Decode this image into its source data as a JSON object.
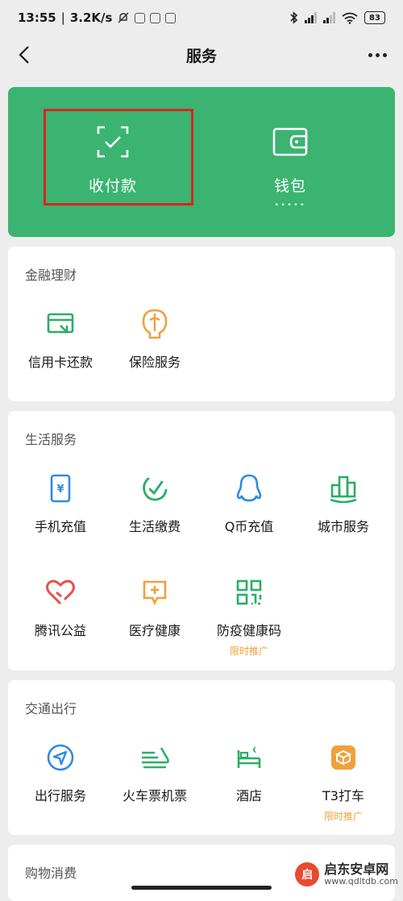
{
  "status_bar": {
    "time": "13:55",
    "speed": "3.2K/s",
    "battery": "83"
  },
  "nav": {
    "title": "服务"
  },
  "hero": {
    "pay_label": "收付款",
    "wallet_label": "钱包",
    "wallet_dots": "•••••"
  },
  "sections": {
    "finance": {
      "title": "金融理财",
      "items": [
        {
          "label": "信用卡还款",
          "icon": "credit-card-icon"
        },
        {
          "label": "保险服务",
          "icon": "insurance-icon"
        }
      ]
    },
    "life": {
      "title": "生活服务",
      "items": [
        {
          "label": "手机充值",
          "icon": "mobile-topup-icon"
        },
        {
          "label": "生活缴费",
          "icon": "utility-bill-icon"
        },
        {
          "label": "Q币充值",
          "icon": "qq-coin-icon"
        },
        {
          "label": "城市服务",
          "icon": "city-services-icon"
        },
        {
          "label": "腾讯公益",
          "icon": "charity-icon"
        },
        {
          "label": "医疗健康",
          "icon": "medical-icon"
        },
        {
          "label": "防疫健康码",
          "icon": "qr-code-icon",
          "badge": "限时推广"
        }
      ]
    },
    "transport": {
      "title": "交通出行",
      "items": [
        {
          "label": "出行服务",
          "icon": "navigation-icon"
        },
        {
          "label": "火车票机票",
          "icon": "train-flight-icon"
        },
        {
          "label": "酒店",
          "icon": "hotel-icon"
        },
        {
          "label": "T3打车",
          "icon": "t3-taxi-icon",
          "badge": "限时推广"
        }
      ]
    },
    "shopping": {
      "title": "购物消费"
    }
  },
  "watermark": {
    "logo": "启",
    "main": "启东安卓网",
    "url": "www.qdltdb.com"
  },
  "colors": {
    "wechat_green": "#3ab470",
    "highlight_red": "#d7261e",
    "promo_orange": "#f0a03c",
    "icon_green": "#2aae67",
    "icon_blue": "#2f8ae5",
    "icon_red": "#e8504d",
    "icon_orange": "#f0a03c"
  }
}
